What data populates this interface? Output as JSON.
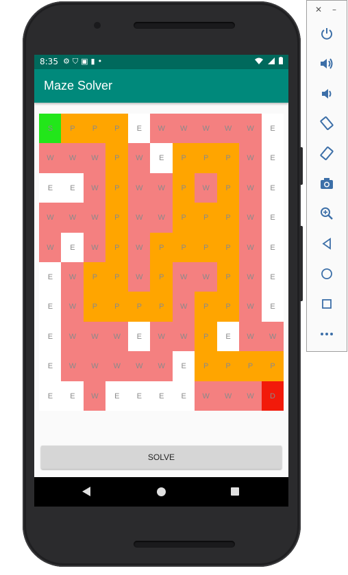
{
  "status_bar": {
    "time": "8:35",
    "left_icons": [
      "gear-icon",
      "shield-icon",
      "a-icon",
      "sd-card-icon",
      "dot-icon"
    ],
    "right_icons": [
      "wifi-icon",
      "signal-icon",
      "battery-icon"
    ]
  },
  "app_bar": {
    "title": "Maze Solver"
  },
  "maze": {
    "rows": [
      [
        "S",
        "P",
        "P",
        "P",
        "E",
        "W",
        "W",
        "W",
        "W",
        "W",
        "E"
      ],
      [
        "W",
        "W",
        "W",
        "P",
        "W",
        "E",
        "P",
        "P",
        "P",
        "W",
        "E"
      ],
      [
        "E",
        "E",
        "W",
        "P",
        "W",
        "W",
        "P",
        "W",
        "P",
        "W",
        "E"
      ],
      [
        "W",
        "W",
        "W",
        "P",
        "W",
        "W",
        "P",
        "P",
        "P",
        "W",
        "E"
      ],
      [
        "W",
        "E",
        "W",
        "P",
        "W",
        "P",
        "P",
        "P",
        "P",
        "W",
        "E"
      ],
      [
        "E",
        "W",
        "P",
        "P",
        "W",
        "P",
        "W",
        "W",
        "P",
        "W",
        "E"
      ],
      [
        "E",
        "W",
        "P",
        "P",
        "P",
        "P",
        "W",
        "P",
        "P",
        "W",
        "E"
      ],
      [
        "E",
        "W",
        "W",
        "W",
        "E",
        "W",
        "W",
        "P",
        "E",
        "W",
        "W"
      ],
      [
        "E",
        "W",
        "W",
        "W",
        "W",
        "W",
        "E",
        "P",
        "P",
        "P",
        "P"
      ],
      [
        "E",
        "E",
        "W",
        "E",
        "E",
        "E",
        "E",
        "W",
        "W",
        "W",
        "D"
      ]
    ],
    "colors": {
      "S": "#22e61a",
      "P": "#ffa500",
      "W": "#f48080",
      "E": "#ffffff",
      "D": "#f21a0a"
    }
  },
  "solve_button": {
    "label": "SOLVE"
  },
  "nav_bar": {
    "icons": [
      "back-icon",
      "home-icon",
      "recents-icon"
    ]
  },
  "emulator_toolbar": {
    "close": "✕",
    "minimize": "–",
    "tools": [
      "power-icon",
      "volume-up-icon",
      "volume-down-icon",
      "rotate-left-icon",
      "rotate-right-icon",
      "camera-icon",
      "zoom-icon",
      "back-icon",
      "home-icon",
      "overview-icon",
      "more-icon"
    ]
  }
}
